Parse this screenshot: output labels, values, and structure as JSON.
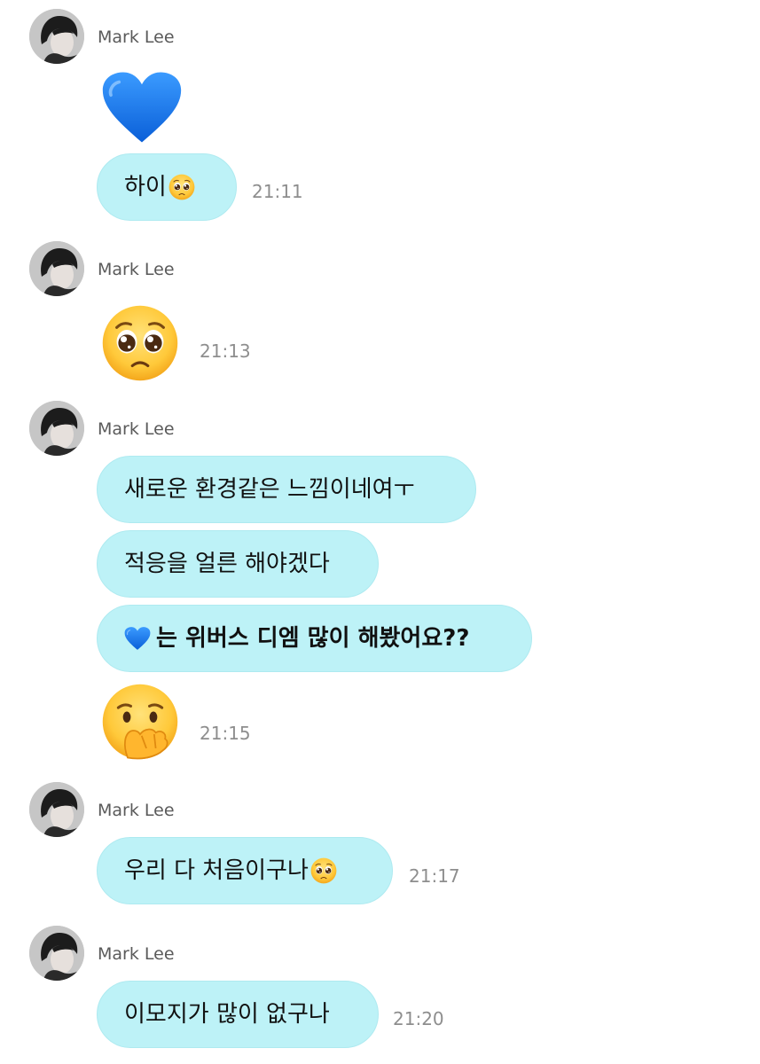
{
  "colors": {
    "bubble": "#bdf2f7",
    "sender_text": "#5a5a5a",
    "time_text": "#8e8e8e",
    "heart": "#1f7ff0"
  },
  "messages": [
    {
      "sender": "Mark Lee",
      "items": [
        {
          "kind": "emoji",
          "icon": "blue-heart-icon"
        },
        {
          "kind": "text",
          "text": "하이",
          "trailing_icon": "pleading-face-icon"
        }
      ],
      "time": "21:11"
    },
    {
      "sender": "Mark Lee",
      "items": [
        {
          "kind": "emoji",
          "icon": "pleading-face-icon"
        }
      ],
      "time": "21:13"
    },
    {
      "sender": "Mark Lee",
      "items": [
        {
          "kind": "text",
          "text": "새로운 환경같은 느낌이네여ㅜ"
        },
        {
          "kind": "text",
          "text": "적응을 얼른 해야겠다"
        },
        {
          "kind": "text",
          "leading_icon": "blue-heart-icon",
          "text": "는 위버스 디엠 많이 해봤어요??"
        },
        {
          "kind": "emoji",
          "icon": "face-with-hand-over-mouth-icon"
        }
      ],
      "time": "21:15"
    },
    {
      "sender": "Mark Lee",
      "items": [
        {
          "kind": "text",
          "text": "우리 다 처음이구나",
          "trailing_icon": "pleading-face-icon"
        }
      ],
      "time": "21:17"
    },
    {
      "sender": "Mark Lee",
      "items": [
        {
          "kind": "text",
          "text": "이모지가 많이 없구나"
        }
      ],
      "time": "21:20"
    }
  ]
}
